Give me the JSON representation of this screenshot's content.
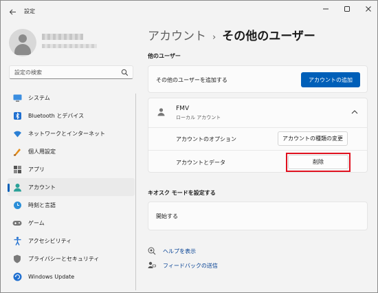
{
  "window": {
    "title": "設定"
  },
  "sidebar": {
    "search_placeholder": "設定の検索",
    "items": [
      {
        "label": "システム",
        "icon": "system-icon"
      },
      {
        "label": "Bluetooth とデバイス",
        "icon": "bluetooth-icon"
      },
      {
        "label": "ネットワークとインターネット",
        "icon": "network-icon"
      },
      {
        "label": "個人用設定",
        "icon": "personalization-icon"
      },
      {
        "label": "アプリ",
        "icon": "apps-icon"
      },
      {
        "label": "アカウント",
        "icon": "accounts-icon",
        "active": true
      },
      {
        "label": "時刻と言語",
        "icon": "time-language-icon"
      },
      {
        "label": "ゲーム",
        "icon": "gaming-icon"
      },
      {
        "label": "アクセシビリティ",
        "icon": "accessibility-icon"
      },
      {
        "label": "プライバシーとセキュリティ",
        "icon": "privacy-icon"
      },
      {
        "label": "Windows Update",
        "icon": "windows-update-icon"
      }
    ]
  },
  "header": {
    "crumb1": "アカウント",
    "separator": "›",
    "crumb2": "その他のユーザー"
  },
  "other_users": {
    "section_title": "他のユーザー",
    "add_label": "その他のユーザーを追加する",
    "add_button": "アカウントの追加",
    "user_name": "FMV",
    "user_type": "ローカル アカウント",
    "options_label": "アカウントのオプション",
    "change_type_button": "アカウントの種類の変更",
    "data_label": "アカウントとデータ",
    "delete_button": "削除"
  },
  "kiosk": {
    "section_title": "キオスク モードを設定する",
    "start_label": "開始する"
  },
  "links": {
    "help": "ヘルプを表示",
    "feedback": "フィードバックの送信"
  },
  "colors": {
    "accent": "#005fb8",
    "highlight": "#e0101e"
  }
}
